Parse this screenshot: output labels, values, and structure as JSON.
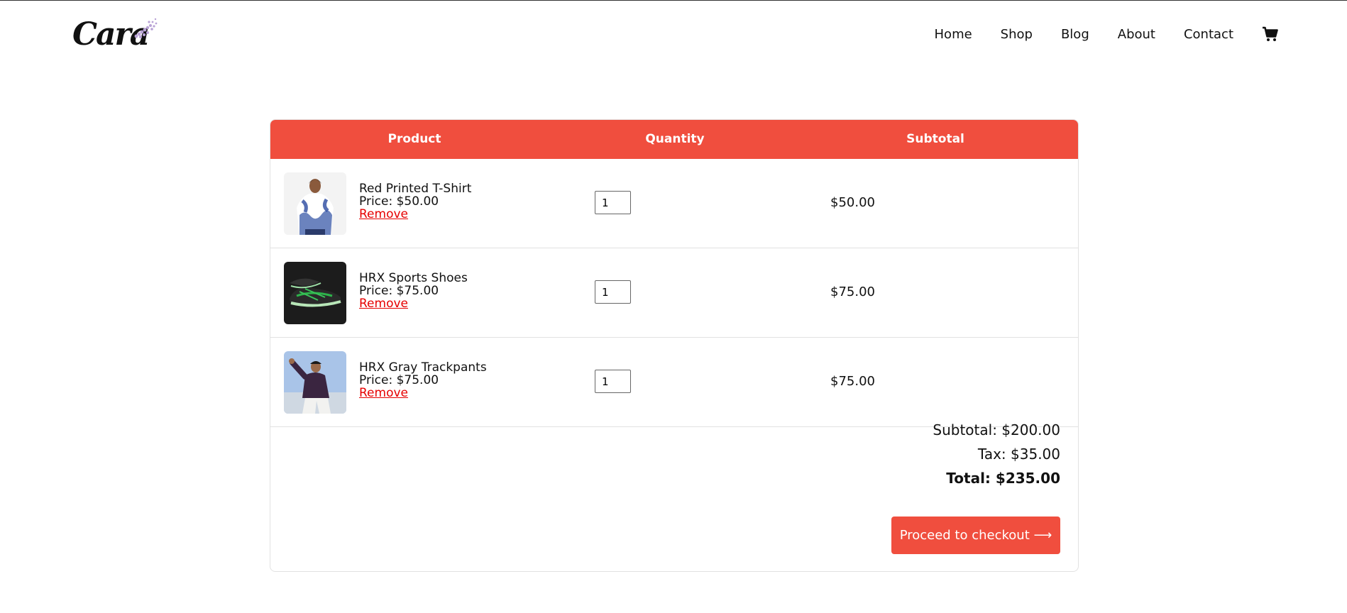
{
  "brand": {
    "logo_text": "Cara"
  },
  "nav": {
    "items": [
      "Home",
      "Shop",
      "Blog",
      "About",
      "Contact"
    ],
    "cart_icon": "cart-icon"
  },
  "table": {
    "headers": {
      "product": "Product",
      "quantity": "Quantity",
      "subtotal": "Subtotal"
    },
    "rows": [
      {
        "name": "Red Printed T-Shirt",
        "price": "Price: $50.00",
        "remove": "Remove",
        "quantity": "1",
        "subtotal": "$50.00"
      },
      {
        "name": "HRX Sports Shoes",
        "price": "Price: $75.00",
        "remove": "Remove",
        "quantity": "1",
        "subtotal": "$75.00"
      },
      {
        "name": "HRX Gray Trackpants",
        "price": "Price: $75.00",
        "remove": "Remove",
        "quantity": "1",
        "subtotal": "$75.00"
      }
    ]
  },
  "summary": {
    "subtotal": "Subtotal: $200.00",
    "tax": "Tax: $35.00",
    "total": "Total: $235.00",
    "checkout_label": "Proceed to checkout ⟶"
  },
  "colors": {
    "accent": "#f04e3e",
    "remove_link": "#e60000"
  }
}
